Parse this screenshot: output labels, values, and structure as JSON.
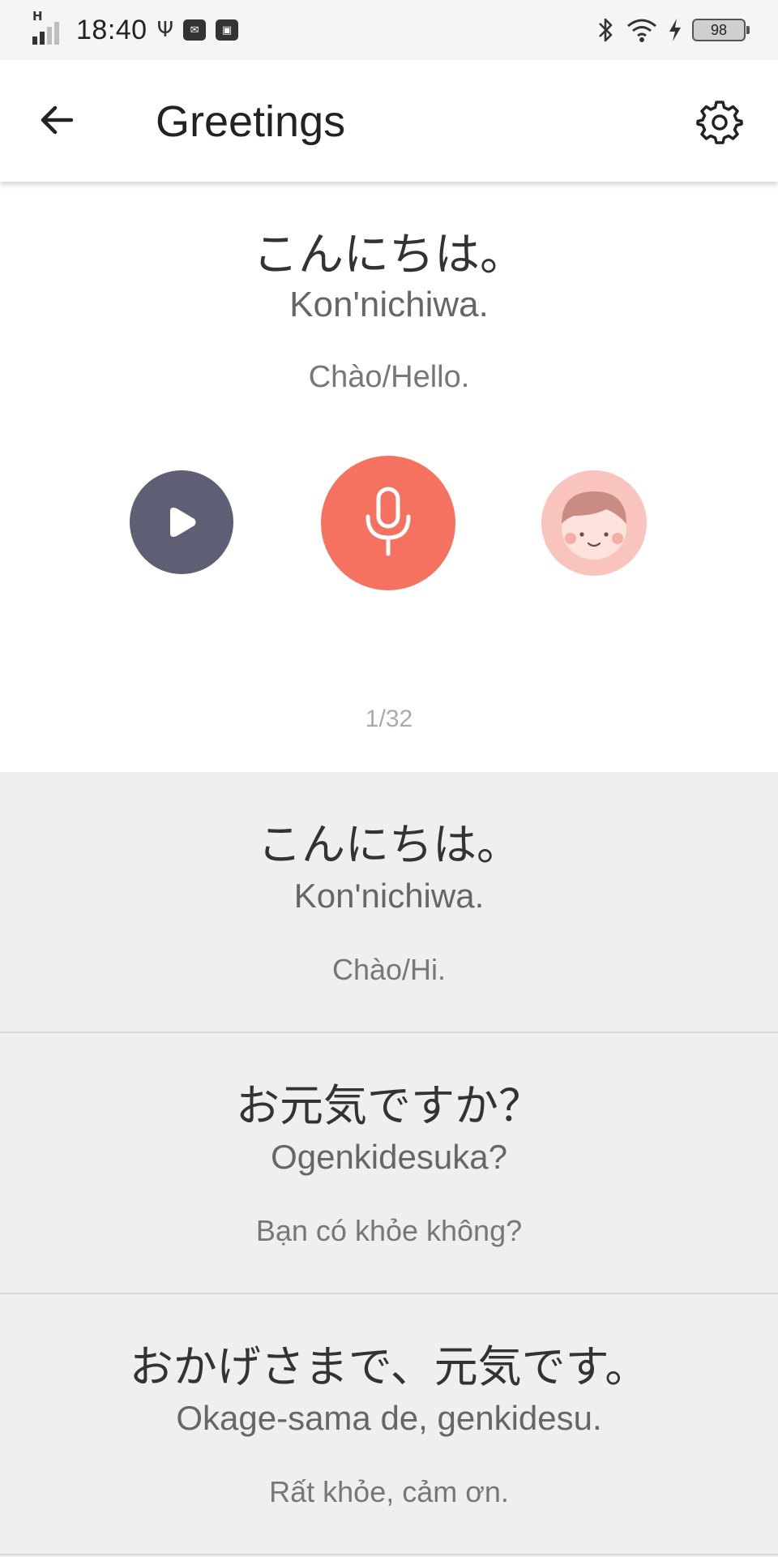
{
  "status_bar": {
    "network_type": "H",
    "time": "18:40",
    "battery_level": "98",
    "icons": [
      "signal-icon",
      "usb-icon",
      "notification-icon",
      "image-icon",
      "bluetooth-icon",
      "wifi-icon",
      "charging-icon",
      "battery-icon"
    ]
  },
  "app_bar": {
    "title": "Greetings",
    "back_icon": "arrow-left-icon",
    "settings_icon": "gear-icon"
  },
  "current_phrase": {
    "japanese": "こんにちは。",
    "romaji": "Kon'nichiwa.",
    "meaning": "Chào/Hello.",
    "counter": "1/32",
    "controls": {
      "play_icon": "play-icon",
      "record_icon": "microphone-icon",
      "playback_icon": "avatar-face-icon"
    }
  },
  "colors": {
    "play_button": "#5e5e74",
    "record_button": "#f4725f",
    "avatar_button": "#f9c4bd",
    "list_background": "#efefef"
  },
  "phrases": [
    {
      "japanese": "こんにちは。",
      "romaji": "Kon'nichiwa.",
      "meaning": "Chào/Hi."
    },
    {
      "japanese": "お元気ですか？",
      "romaji": "Ogenkidesuka?",
      "meaning": "Bạn có khỏe không?"
    },
    {
      "japanese": "おかげさまで、元気です。",
      "romaji": "Okage-sama de, genkidesu.",
      "meaning": "Rất khỏe, cảm ơn."
    }
  ]
}
